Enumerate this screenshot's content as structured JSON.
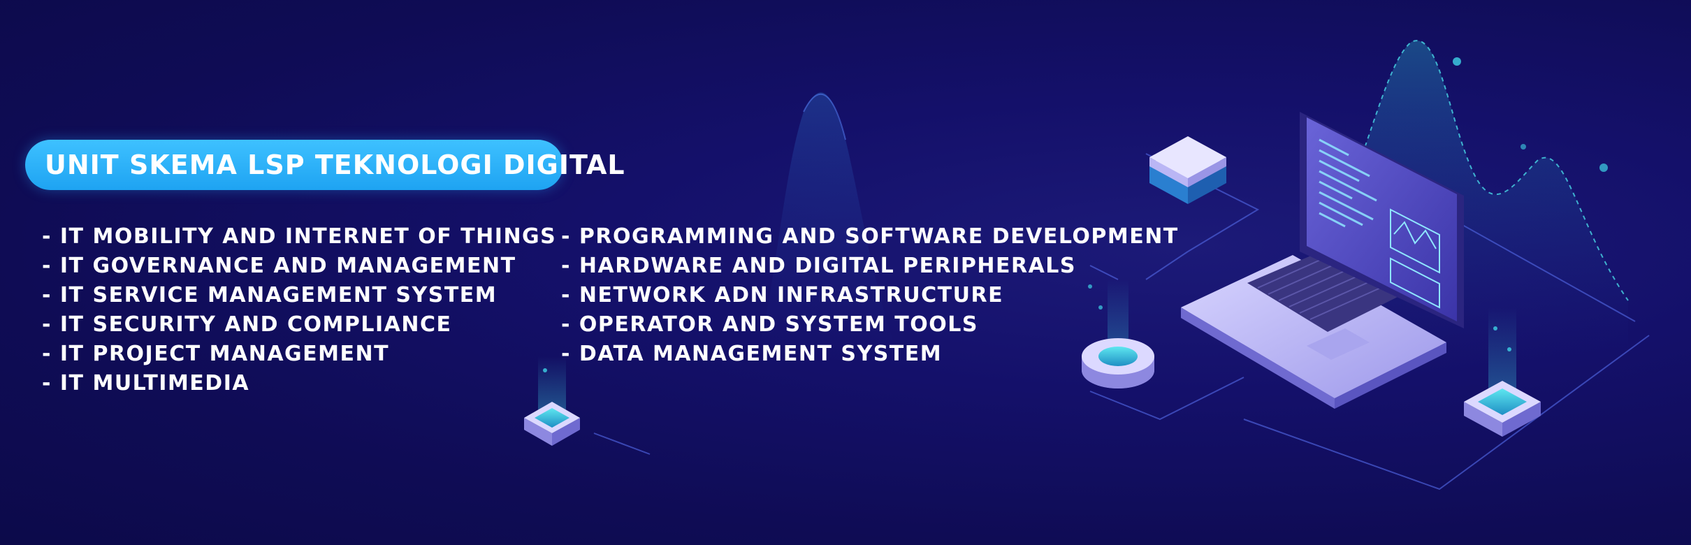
{
  "banner": {
    "heading": "UNIT SKEMA LSP TEKNOLOGI DIGITAL",
    "left_items": [
      "- IT MOBILITY AND INTERNET OF THINGS",
      "- IT GOVERNANCE AND MANAGEMENT",
      "- IT SERVICE MANAGEMENT SYSTEM",
      "- IT SECURITY AND COMPLIANCE",
      "- IT PROJECT MANAGEMENT",
      "- IT MULTIMEDIA"
    ],
    "right_items": [
      "- PROGRAMMING AND SOFTWARE DEVELOPMENT",
      "- HARDWARE AND DIGITAL PERIPHERALS",
      "- NETWORK ADN INFRASTRUCTURE",
      "- OPERATOR AND SYSTEM TOOLS",
      "- DATA MANAGEMENT SYSTEM"
    ]
  },
  "colors": {
    "background": "#14106a",
    "accent": "#2bb3ff",
    "text": "#ffffff",
    "laptop_screen": "#5a55c9",
    "laptop_body": "#c9c6ff",
    "teal_glow": "#3fd3e6"
  },
  "icons": {
    "laptop": "laptop-illustration",
    "chips": "isometric-chip-icons",
    "ring": "isometric-ring-icon"
  }
}
